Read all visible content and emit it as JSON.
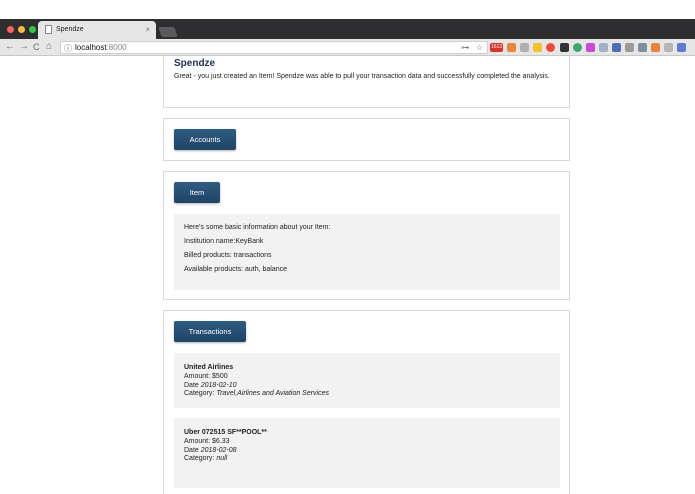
{
  "browser": {
    "tab_title": "Spendze",
    "tab_close": "×",
    "url_host": "localhost",
    "url_port": ":8000",
    "nav_back": "←",
    "nav_forward": "→",
    "nav_reload": "C",
    "nav_home": "⌂",
    "omnibox_info": "ⓘ",
    "key_icon": "⊶",
    "star_icon": "☆",
    "ext_badge": "1613"
  },
  "header": {
    "title": "Spendze",
    "message": "Great - you just created an Item! Spendze was able to pull your transaction data and successfully completed the analysis."
  },
  "accounts": {
    "button_label": "Accounts"
  },
  "item": {
    "button_label": "Item",
    "intro": "Here's some basic information about your Item:",
    "institution": "Institution name:KeyBank",
    "billed": "Billed products: transactions",
    "available": "Available products: auth, balance"
  },
  "transactions": {
    "button_label": "Transactions",
    "amount_label": "Amount:",
    "date_label": "Date",
    "category_label": "Category:",
    "items": [
      {
        "name": "United Airlines",
        "amount": "$500",
        "date": "2018-02-10",
        "category": "Travel,Airlines and Aviation Services"
      },
      {
        "name": "Uber 072515 SF**POOL**",
        "amount": "$6.33",
        "date": "2018-02-08",
        "category": "null"
      }
    ]
  },
  "colors": {
    "button": "#1f4466",
    "title": "#222f5a",
    "panel": "#f2f2f2",
    "chrome_dark": "#2e2e30",
    "chrome_light": "#e6e6e6"
  }
}
